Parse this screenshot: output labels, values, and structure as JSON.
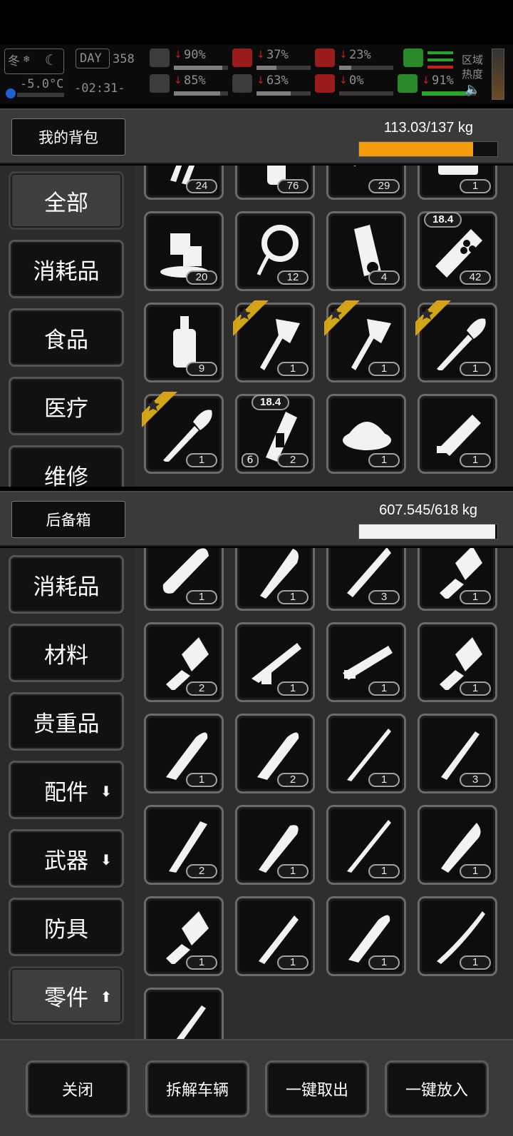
{
  "hud": {
    "season": "冬",
    "day_label": "DAY",
    "day_number": "358",
    "temperature": "-5.0°C",
    "clock": "-02:31-",
    "area_heat_label_1": "区域",
    "area_heat_label_2": "热度",
    "stats": [
      {
        "icon": "medkit-icon",
        "value": "90%",
        "fraction": 0.9,
        "col": 0,
        "row": 0
      },
      {
        "icon": "brain-icon",
        "value": "85%",
        "fraction": 0.85,
        "col": 0,
        "row": 1
      },
      {
        "icon": "stomach-icon",
        "value": "37%",
        "fraction": 0.37,
        "col": 1,
        "row": 0
      },
      {
        "icon": "water-drop-icon",
        "value": "63%",
        "fraction": 0.63,
        "col": 1,
        "row": 1
      },
      {
        "icon": "mask-icon",
        "value": "23%",
        "fraction": 0.23,
        "col": 2,
        "row": 0
      },
      {
        "icon": "heart-icon",
        "value": "0%",
        "fraction": 0.0,
        "col": 2,
        "row": 1
      },
      {
        "icon": "boot-icon",
        "value": "91%",
        "fraction": 0.91,
        "col": 3,
        "row": 1
      }
    ]
  },
  "backpack": {
    "title": "我的背包",
    "weight": "113.03/137 kg",
    "weight_fraction": 0.825,
    "bar_color": "#f39c0b",
    "categories": [
      {
        "label": "全部",
        "active": true
      },
      {
        "label": "消耗品"
      },
      {
        "label": "食品"
      },
      {
        "label": "医疗"
      },
      {
        "label": "维修"
      }
    ],
    "items": [
      {
        "icon": "tools-icon",
        "count": "24"
      },
      {
        "icon": "bottle-icon",
        "count": "76"
      },
      {
        "icon": "bandage-roll-icon",
        "count": "29"
      },
      {
        "icon": "device-icon",
        "count": "1"
      },
      {
        "icon": "ice-cubes-icon",
        "count": "20"
      },
      {
        "icon": "rope-icon",
        "count": "12"
      },
      {
        "icon": "cloth-roll-icon",
        "count": "4"
      },
      {
        "icon": "shell-pack-icon",
        "count": "42",
        "durability": "18.4"
      },
      {
        "icon": "whiskey-bottle-icon",
        "count": "9"
      },
      {
        "icon": "axe-icon",
        "count": "1",
        "star": true
      },
      {
        "icon": "axe-icon",
        "count": "1",
        "star": true
      },
      {
        "icon": "shovel-icon",
        "count": "1",
        "star": true
      },
      {
        "icon": "shovel-icon",
        "count": "1",
        "star": true
      },
      {
        "icon": "utility-knife-icon",
        "count": "2",
        "durability": "18.4",
        "sub_count": "6"
      },
      {
        "icon": "food-bowl-icon",
        "count": "1"
      },
      {
        "icon": "gatling-gun-icon",
        "count": "1"
      }
    ]
  },
  "trunk": {
    "title": "后备箱",
    "weight": "607.545/618 kg",
    "weight_fraction": 0.983,
    "bar_color": "#f2f2f5",
    "categories": [
      {
        "label": "消耗品"
      },
      {
        "label": "材料"
      },
      {
        "label": "贵重品"
      },
      {
        "label": "配件",
        "arrow": "down"
      },
      {
        "label": "武器",
        "arrow": "down"
      },
      {
        "label": "防具"
      },
      {
        "label": "零件",
        "arrow": "up",
        "active": true
      }
    ],
    "items": [
      {
        "icon": "chainsaw-icon",
        "count": "1"
      },
      {
        "icon": "machete-icon",
        "count": "1"
      },
      {
        "icon": "saw-blade-icon",
        "count": "3"
      },
      {
        "icon": "cleaver-icon",
        "count": "1"
      },
      {
        "icon": "cleaver-icon",
        "count": "2"
      },
      {
        "icon": "rifle-icon",
        "count": "1"
      },
      {
        "icon": "rocket-launcher-icon",
        "count": "1"
      },
      {
        "icon": "cleaver-icon",
        "count": "1"
      },
      {
        "icon": "combat-knife-icon",
        "count": "1"
      },
      {
        "icon": "combat-knife-icon",
        "count": "2"
      },
      {
        "icon": "spear-icon",
        "count": "1"
      },
      {
        "icon": "dagger-icon",
        "count": "3"
      },
      {
        "icon": "serrated-blade-icon",
        "count": "2"
      },
      {
        "icon": "broad-blade-icon",
        "count": "1"
      },
      {
        "icon": "spear-icon",
        "count": "1"
      },
      {
        "icon": "curved-blade-icon",
        "count": "1"
      },
      {
        "icon": "cleaver-icon",
        "count": "1"
      },
      {
        "icon": "knife-icon",
        "count": "1"
      },
      {
        "icon": "combat-knife-icon",
        "count": "1"
      },
      {
        "icon": "katana-icon",
        "count": "1"
      },
      {
        "icon": "dagger-icon",
        "count": ""
      }
    ]
  },
  "actions": [
    {
      "label": "关闭",
      "name": "close-button"
    },
    {
      "label": "拆解车辆",
      "name": "dismantle-vehicle-button"
    },
    {
      "label": "一键取出",
      "name": "take-all-button"
    },
    {
      "label": "一键放入",
      "name": "put-all-button"
    }
  ]
}
